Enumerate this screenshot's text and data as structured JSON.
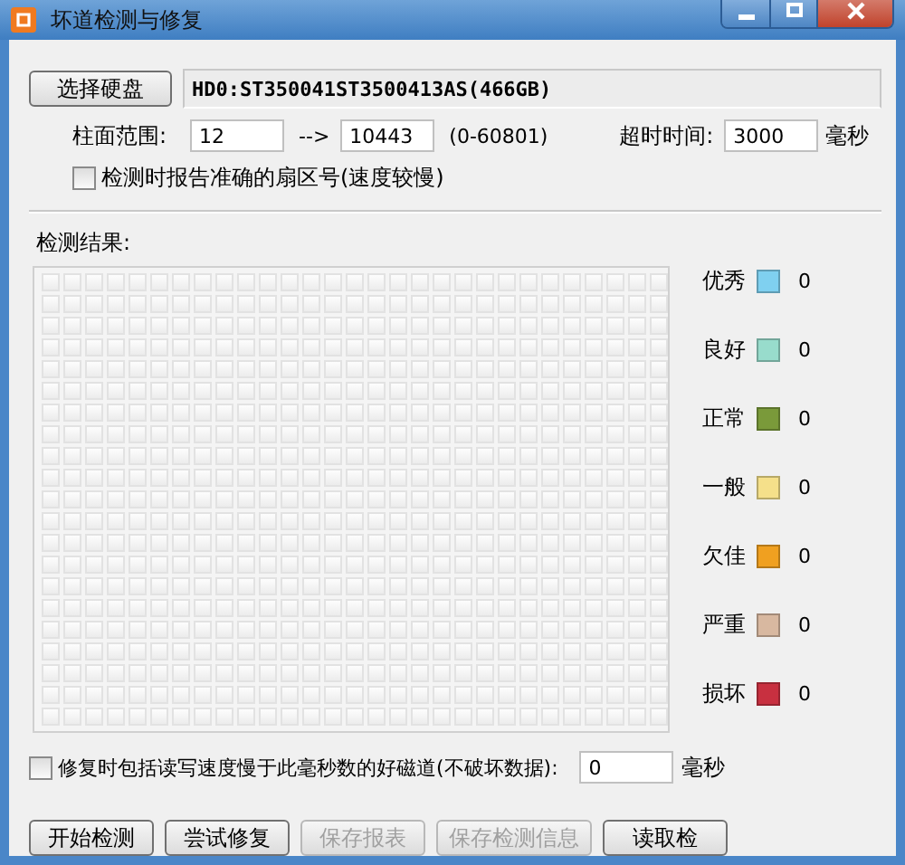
{
  "window": {
    "title": "坏道检测与修复"
  },
  "disk": {
    "button": "选择硬盘",
    "label": "HD0:ST350041ST3500413AS(466GB)"
  },
  "range": {
    "label": "柱面范围:",
    "from": "12",
    "arrow": "-->",
    "to": "10443",
    "hint": "(0-60801)"
  },
  "timeout": {
    "label": "超时时间:",
    "value": "3000",
    "unit": "毫秒"
  },
  "report_sectors": {
    "label": "检测时报告准确的扇区号(速度较慢)",
    "checked": false
  },
  "results": {
    "label": "检测结果:"
  },
  "legend": [
    {
      "label": "优秀",
      "color": "#7fd0f0",
      "count": "0"
    },
    {
      "label": "良好",
      "color": "#98dccc",
      "count": "0"
    },
    {
      "label": "正常",
      "color": "#7a9a3a",
      "count": "0"
    },
    {
      "label": "一般",
      "color": "#f5e08a",
      "count": "0"
    },
    {
      "label": "欠佳",
      "color": "#f0a020",
      "count": "0"
    },
    {
      "label": "严重",
      "color": "#d8b8a0",
      "count": "0"
    },
    {
      "label": "损坏",
      "color": "#c83040",
      "count": "0"
    }
  ],
  "repair_slow": {
    "label": "修复时包括读写速度慢于此毫秒数的好磁道(不破坏数据):",
    "checked": false,
    "value": "0",
    "unit": "毫秒"
  },
  "buttons": [
    {
      "label": "开始检测",
      "disabled": false
    },
    {
      "label": "尝试修复",
      "disabled": false
    },
    {
      "label": "保存报表",
      "disabled": true
    },
    {
      "label": "保存检测信息",
      "disabled": true
    },
    {
      "label": "读取检",
      "disabled": false
    }
  ]
}
